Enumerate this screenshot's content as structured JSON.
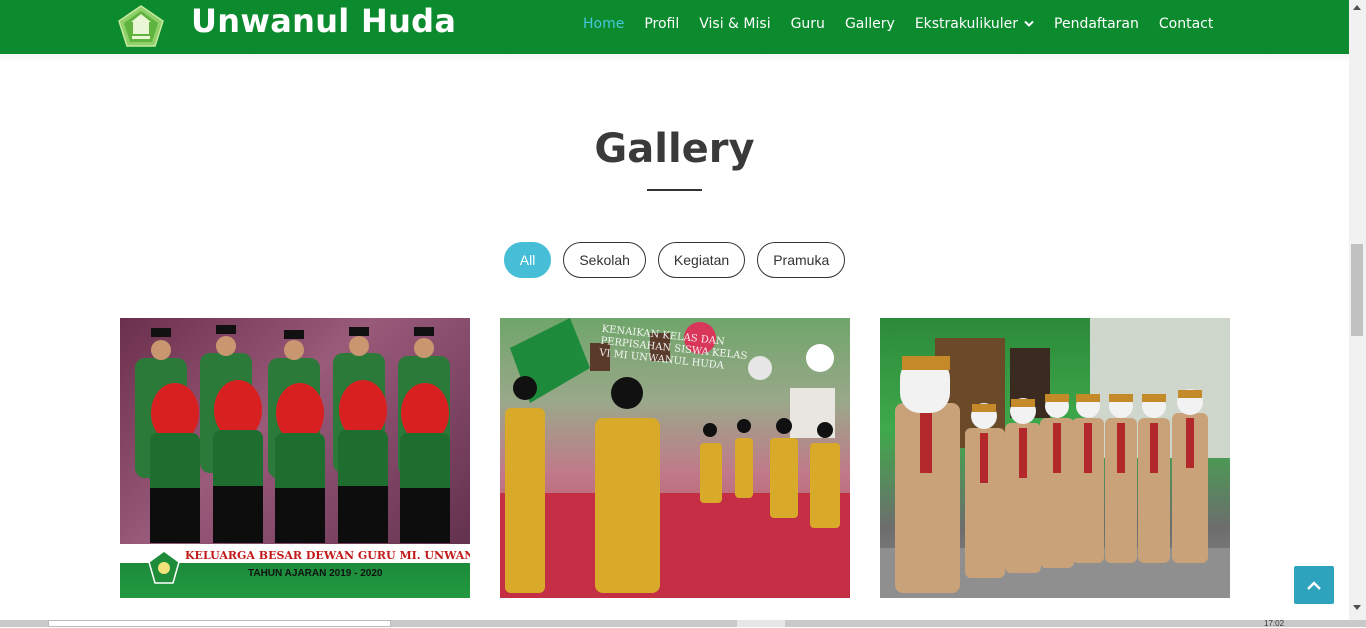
{
  "site": {
    "brand": "Unwanul Huda",
    "logo_icon": "school-logo-icon"
  },
  "nav": {
    "items": [
      {
        "label": "Home",
        "active": true
      },
      {
        "label": "Profil"
      },
      {
        "label": "Visi & Misi"
      },
      {
        "label": "Guru"
      },
      {
        "label": "Gallery"
      },
      {
        "label": "Ekstrakulikuler",
        "dropdown": true
      },
      {
        "label": "Pendaftaran"
      },
      {
        "label": "Contact"
      }
    ]
  },
  "gallery": {
    "title": "Gallery",
    "filters": [
      {
        "label": "All",
        "active": true
      },
      {
        "label": "Sekolah"
      },
      {
        "label": "Kegiatan"
      },
      {
        "label": "Pramuka"
      }
    ],
    "photos": [
      {
        "alt": "teachers group photo",
        "caption_line1": "KELUARGA BESAR DEWAN GURU MI. UNWANUL HUDA",
        "caption_line2": "TAHUN AJARAN 2019 - 2020"
      },
      {
        "alt": "students dance performance",
        "banner": "KENAIKAN KELAS DAN PERPISAHAN SISWA KELAS VI MI UNWANUL HUDA"
      },
      {
        "alt": "scout students"
      }
    ]
  },
  "taskbar": {
    "time": "17:02"
  },
  "colors": {
    "navbar": "#0b8a2e",
    "accent": "#46bed7",
    "active_link": "#48c6dc",
    "scroll_button": "#2da3bd"
  }
}
